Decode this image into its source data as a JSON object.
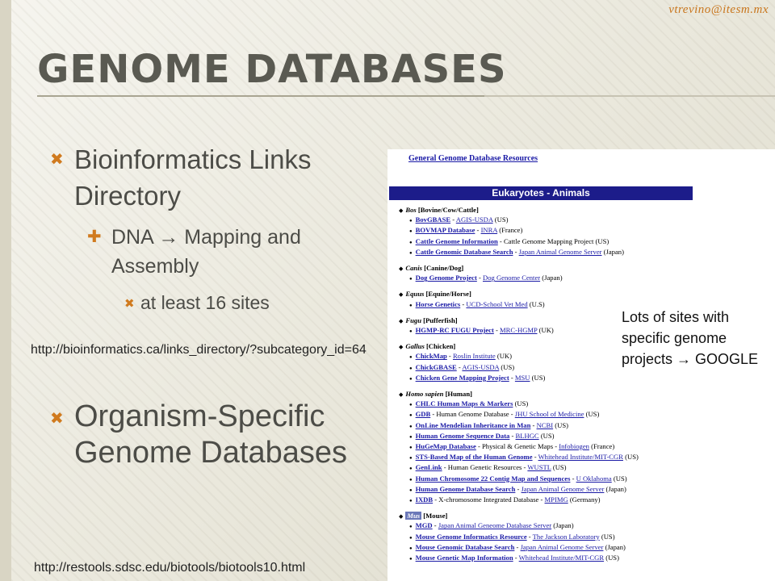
{
  "author": "vtrevino@itesm.mx",
  "title": "Genome Databases",
  "bullets": {
    "level1_a": "Bioinformatics Links Directory",
    "level2": "DNA → Mapping and Assembly",
    "level3": "at least 16 sites",
    "level1_b": "Organism-Specific Genome Databases"
  },
  "markers": {
    "l1": "✖",
    "l2": "✚",
    "l3": "✖"
  },
  "urls": {
    "links_directory": "http://bioinformatics.ca/links_directory/?subcategory_id=64",
    "biotools": "http://restools.sdsc.edu/biotools/biotools10.html"
  },
  "note": "Lots of sites with specific genome projects → GOOGLE",
  "screenshot": {
    "top_link": "General Genome Database Resources",
    "header": "Eukaryotes - Animals",
    "groups": [
      {
        "name": "Bos",
        "desc": " [Bovine/Cow/Cattle]",
        "items": [
          [
            [
              "BovGBASE",
              true
            ],
            [
              " - ",
              false
            ],
            [
              "AGIS-USDA",
              true
            ],
            [
              " (US)",
              false
            ]
          ],
          [
            [
              "BOVMAP Database",
              true
            ],
            [
              " - ",
              false
            ],
            [
              "INRA",
              true
            ],
            [
              " (France)",
              false
            ]
          ],
          [
            [
              "Cattle Genome Information",
              true
            ],
            [
              " - Cattle Genome Mapping Project (US)",
              false
            ]
          ],
          [
            [
              "Cattle Genomic Database Search",
              true
            ],
            [
              " - ",
              false
            ],
            [
              "Japan Animal Genome Server",
              true
            ],
            [
              " (Japan)",
              false
            ]
          ]
        ]
      },
      {
        "name": "Canis",
        "desc": " [Canine/Dog]",
        "items": [
          [
            [
              "Dog Genome Project",
              true
            ],
            [
              " - ",
              false
            ],
            [
              "Dog Genome Center",
              true
            ],
            [
              " (Japan)",
              false
            ]
          ]
        ]
      },
      {
        "name": "Equus",
        "desc": " [Equine/Horse]",
        "items": [
          [
            [
              "Horse Genetics",
              true
            ],
            [
              " - ",
              false
            ],
            [
              "UCD-School Vet Med",
              true
            ],
            [
              " (U.S)",
              false
            ]
          ]
        ]
      },
      {
        "name": "Fugu",
        "desc": " [Pufferfish]",
        "items": [
          [
            [
              "HGMP-RC FUGU Project",
              true
            ],
            [
              " - ",
              false
            ],
            [
              "MRC-HGMP",
              true
            ],
            [
              " (UK)",
              false
            ]
          ]
        ]
      },
      {
        "name": "Gallus",
        "desc": " [Chicken]",
        "items": [
          [
            [
              "ChickMap",
              true
            ],
            [
              " - ",
              false
            ],
            [
              "Roslin Institute",
              true
            ],
            [
              " (UK)",
              false
            ]
          ],
          [
            [
              "ChickGBASE",
              true
            ],
            [
              " - ",
              false
            ],
            [
              "AGIS-USDA",
              true
            ],
            [
              " (US)",
              false
            ]
          ],
          [
            [
              "Chicken Gene Mapping Project",
              true
            ],
            [
              " - ",
              false
            ],
            [
              "MSU",
              true
            ],
            [
              " (US)",
              false
            ]
          ]
        ]
      },
      {
        "name": "Homo sapien",
        "desc": " [Human]",
        "items": [
          [
            [
              "CHLC Human Maps & Markers",
              true
            ],
            [
              " (US)",
              false
            ]
          ],
          [
            [
              "GDB",
              true
            ],
            [
              " - Human Genome Database - ",
              false
            ],
            [
              "JHU School of Medicine",
              true
            ],
            [
              " (US)",
              false
            ]
          ],
          [
            [
              "OnLine Mendelian Inheritance in Man",
              true
            ],
            [
              " - ",
              false
            ],
            [
              "NCBI",
              true
            ],
            [
              " (US)",
              false
            ]
          ],
          [
            [
              "Human Genome Sequence Data",
              true
            ],
            [
              " - ",
              false
            ],
            [
              "BLHGC",
              true
            ],
            [
              " (US)",
              false
            ]
          ],
          [
            [
              "HuGeMap Database",
              true
            ],
            [
              " - Physical & Genetic Maps - ",
              false
            ],
            [
              "Infobiogen",
              true
            ],
            [
              " (France)",
              false
            ]
          ],
          [
            [
              "STS-Based Map of the Human Genome",
              true
            ],
            [
              " - ",
              false
            ],
            [
              "Whitehead Institute/MIT-CGR",
              true
            ],
            [
              " (US)",
              false
            ]
          ],
          [
            [
              "GenLink",
              true
            ],
            [
              " - Human Genetic Resources - ",
              false
            ],
            [
              "WUSTL",
              true
            ],
            [
              " (US)",
              false
            ]
          ],
          [
            [
              "Human Chromosome 22 Contig Map and Sequences",
              true
            ],
            [
              " - ",
              false
            ],
            [
              "U Oklahoma",
              true
            ],
            [
              " (US)",
              false
            ]
          ],
          [
            [
              "Human Genome Database Search",
              true
            ],
            [
              " - ",
              false
            ],
            [
              "Japan Animal Genome Server",
              true
            ],
            [
              " (Japan)",
              false
            ]
          ],
          [
            [
              "IXDB",
              true
            ],
            [
              " - X-chromosome Integrated Database - ",
              false
            ],
            [
              "MPIMG",
              true
            ],
            [
              " (Germany)",
              false
            ]
          ]
        ]
      },
      {
        "name": "Mus",
        "desc": " [Mouse]",
        "highlight": true,
        "items": [
          [
            [
              "MGD",
              true
            ],
            [
              " - ",
              false
            ],
            [
              "Japan Animal Geneome Database Server",
              true
            ],
            [
              " (Japan)",
              false
            ]
          ],
          [
            [
              "Mouse Genome Informatics Resource",
              true
            ],
            [
              " - ",
              false
            ],
            [
              "The Jackson Laboratory",
              true
            ],
            [
              " (US)",
              false
            ]
          ],
          [
            [
              "Mouse Genomic Database Search",
              true
            ],
            [
              " - ",
              false
            ],
            [
              "Japan Animal Genome Server",
              true
            ],
            [
              " (Japan)",
              false
            ]
          ],
          [
            [
              "Mouse Genetic Map Information",
              true
            ],
            [
              " - ",
              false
            ],
            [
              "Whitehead Institute/MIT-CGR",
              true
            ],
            [
              " (US)",
              false
            ]
          ]
        ]
      }
    ]
  }
}
